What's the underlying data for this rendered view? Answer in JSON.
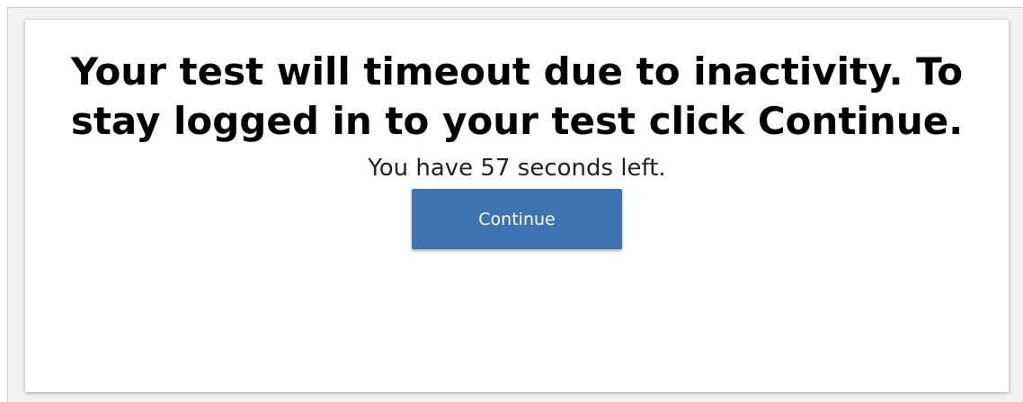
{
  "dialog": {
    "headline": "Your test will timeout due to inactivity. To stay logged in to your test click Continue.",
    "countdown": {
      "text": "You have 57 seconds left."
    },
    "continue_label": "Continue"
  },
  "colors": {
    "button": "#3c73b0",
    "button_text": "#ffffff",
    "headline": "#000000"
  }
}
